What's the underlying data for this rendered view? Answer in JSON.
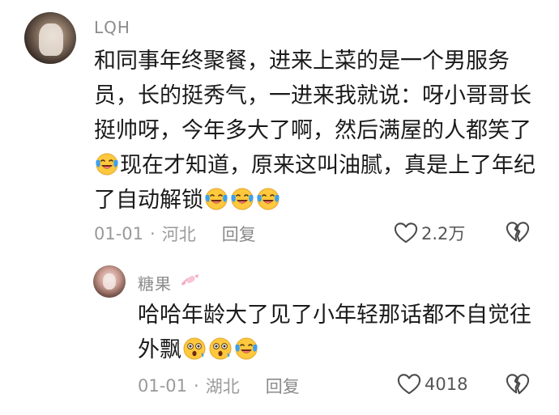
{
  "comment": {
    "username": "LQH",
    "text_before_emoji": "和同事年终聚餐，进来上菜的是一个男服务员，长的挺秀气，一进来我就说：呀小哥哥长挺帅呀，今年多大了啊，然后满屋的人都笑了",
    "text_middle": "现在才知道，原来这叫油腻，真是上了年纪了自动解锁",
    "date": "01-01",
    "location": "河北",
    "reply_label": "回复",
    "likes": "2.2万",
    "icons": [
      "avatar",
      "laugh-cry-emoji",
      "heart-outline-icon",
      "broken-heart-icon"
    ]
  },
  "reply": {
    "username": "糖果",
    "badge_icon": "candy-badge-icon",
    "text": "哈哈年龄大了见了小年轻那话都不自觉往外飘",
    "date": "01-01",
    "location": "湖北",
    "reply_label": "回复",
    "likes": "4018",
    "icons": [
      "avatar",
      "surprised-emoji",
      "laugh-cry-emoji",
      "heart-outline-icon",
      "broken-heart-icon"
    ]
  },
  "colors": {
    "text": "#1a1a1a",
    "meta": "#9a9a9a",
    "emoji_face": "#ffc83d",
    "tear": "#3aa0f0"
  }
}
